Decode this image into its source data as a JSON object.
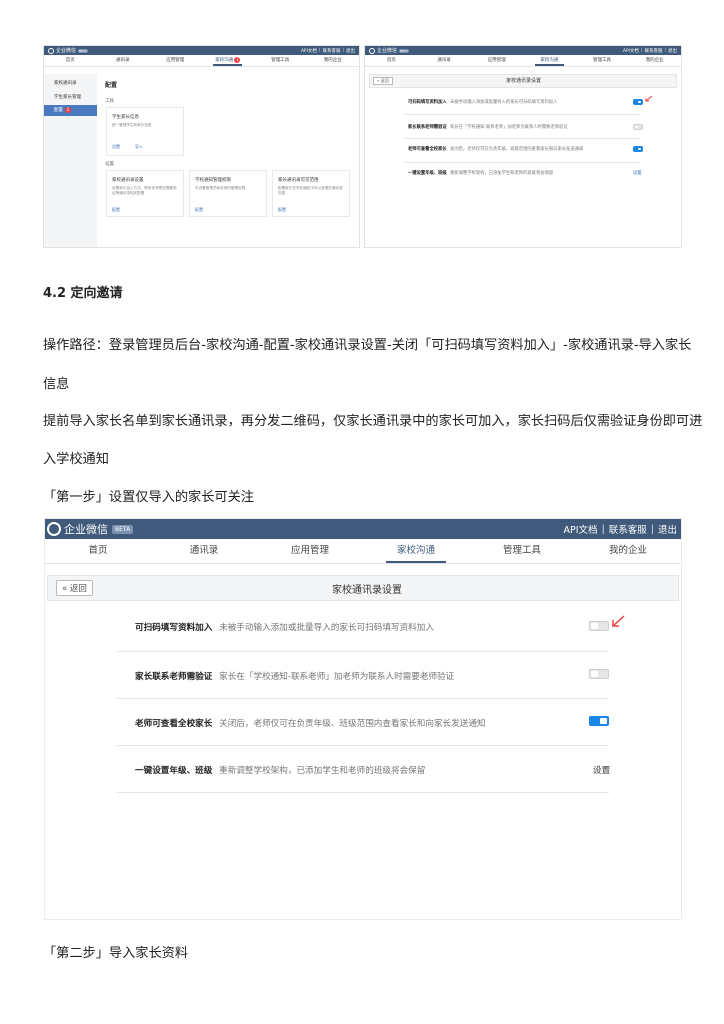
{
  "section_heading": "4.2 定向邀请",
  "para1_line1": "操作路径：登录管理员后台-家校沟通-配置-家校通讯录设置-关闭「可扫码填写资料加入」-家校通讯录-导入家长",
  "para1_line2": "信息",
  "para2_line1": "提前导入家长名单到家长通讯录，再分发二维码，仅家长通讯录中的家长可加入，家长扫码后仅需验证身份即可进",
  "para2_line2": "入学校通知",
  "step1": "「第一步」设置仅导入的家长可关注",
  "step2": "「第二步」导入家长资料",
  "app": {
    "brand": "企业微信",
    "beta": "BETA",
    "api_doc": "API文档",
    "contact_support": "联系客服",
    "logout": "退出",
    "sep": "|"
  },
  "nav": [
    "首页",
    "通讯录",
    "应用管理",
    "家校沟通",
    "管理工具",
    "我的企业"
  ],
  "nav_badge": "1",
  "back_button": "« 返回",
  "settings_title": "家校通讯录设置",
  "settings": [
    {
      "title": "可扫码填写资料加入",
      "desc": "未被手动输入添加或批量导入的家长可扫码填写资料加入",
      "state": "off"
    },
    {
      "title": "家长联系老师需验证",
      "desc": "家长在「学校通知-联系老师」加老师为联系人时需要老师验证",
      "state": "off"
    },
    {
      "title": "老师可查看全校家长",
      "desc": "关闭后，老师仅可在负责年级、班级范围内查看家长和向家长发送通知",
      "state": "on"
    },
    {
      "title": "一键设置年级、班级",
      "desc": "重新调整学校架构，已添加学生和老师的班级将会保留",
      "action": "设置"
    }
  ],
  "left_panel": {
    "sidebar": [
      "家校通讯录",
      "学生家长管理",
      "配置"
    ],
    "sidebar_badge": "1",
    "page_title": "配置",
    "group1": "工具",
    "group2": "设置",
    "card1_title": "学生家长信息",
    "card1_desc": "统一管理学生和家长信息",
    "card1_links": [
      "设置",
      "导入"
    ],
    "cards": [
      {
        "title": "家校通讯录设置",
        "desc": "设置家长加入方式、联系老师是否需要验证等通讯录相关配置",
        "link": "配置"
      },
      {
        "title": "学校通知管理权限",
        "desc": "可设置管理员和老师的管理权限",
        "link": "配置"
      },
      {
        "title": "家长通讯录可见范围",
        "desc": "配置家长在学校通知中可以查看的通讯录范围",
        "link": "配置"
      }
    ]
  },
  "colors": {
    "topbar": "#3f5a7a",
    "toggle_on": "#1a86e8",
    "arrow": "#e64340"
  }
}
